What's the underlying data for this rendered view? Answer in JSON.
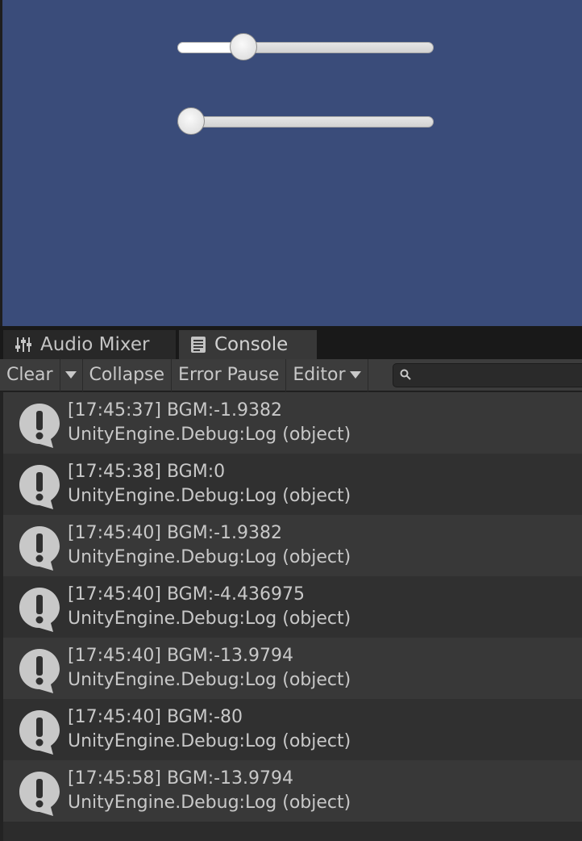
{
  "game_view": {
    "sliders": [
      {
        "name": "slider-one",
        "value": 0.23
      },
      {
        "name": "slider-two",
        "value": 0.0
      }
    ]
  },
  "tabs": [
    {
      "label": "Audio Mixer",
      "icon": "audio-mixer-icon"
    },
    {
      "label": "Console",
      "icon": "console-icon"
    }
  ],
  "toolbar": {
    "clear_label": "Clear",
    "collapse_label": "Collapse",
    "error_pause_label": "Error Pause",
    "editor_label": "Editor",
    "search_placeholder": ""
  },
  "logs": [
    {
      "message": "[17:45:37] BGM:-1.9382",
      "trace": "UnityEngine.Debug:Log (object)"
    },
    {
      "message": "[17:45:38] BGM:0",
      "trace": "UnityEngine.Debug:Log (object)"
    },
    {
      "message": "[17:45:40] BGM:-1.9382",
      "trace": "UnityEngine.Debug:Log (object)"
    },
    {
      "message": "[17:45:40] BGM:-4.436975",
      "trace": "UnityEngine.Debug:Log (object)"
    },
    {
      "message": "[17:45:40] BGM:-13.9794",
      "trace": "UnityEngine.Debug:Log (object)"
    },
    {
      "message": "[17:45:40] BGM:-80",
      "trace": "UnityEngine.Debug:Log (object)"
    },
    {
      "message": "[17:45:58] BGM:-13.9794",
      "trace": "UnityEngine.Debug:Log (object)"
    }
  ],
  "colors": {
    "game_background": "#3a4c7a",
    "console_background": "#2c2c2c",
    "text": "#c8c8c8",
    "info_icon": "#c8c8c8"
  }
}
